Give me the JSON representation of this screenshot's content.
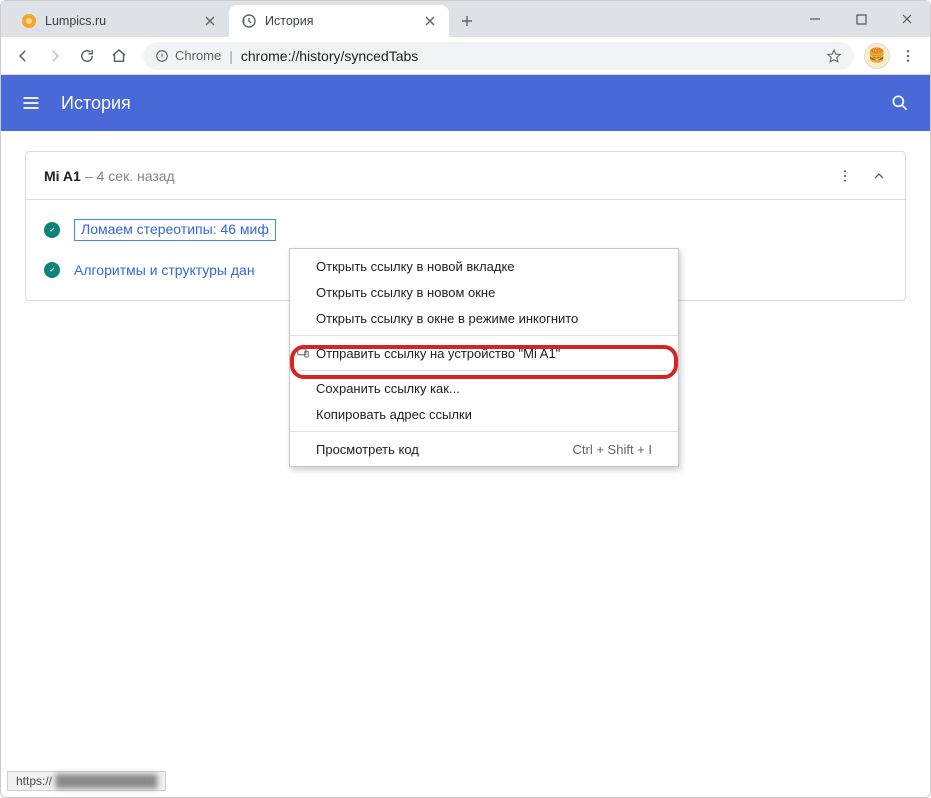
{
  "window": {
    "tabs": [
      {
        "title": "Lumpics.ru",
        "active": false
      },
      {
        "title": "История",
        "active": true
      }
    ]
  },
  "toolbar": {
    "chrome_label": "Chrome",
    "url_path": "chrome://history/syncedTabs"
  },
  "app": {
    "title": "История"
  },
  "device": {
    "name": "Mi A1",
    "time_sep": " – ",
    "time": "4 сек. назад"
  },
  "entries": [
    {
      "title": "Ломаем стереотипы: 46 миф",
      "selected": true
    },
    {
      "title": "Алгоритмы и структуры дан",
      "selected": false
    }
  ],
  "context_menu": {
    "items": [
      {
        "label": "Открыть ссылку в новой вкладке"
      },
      {
        "label": "Открыть ссылку в новом окне"
      },
      {
        "label": "Открыть ссылку в окне в режиме инкогнито"
      }
    ],
    "send_item": {
      "label": "Отправить ссылку на устройство \"Mi A1\""
    },
    "items2": [
      {
        "label": "Сохранить ссылку как..."
      },
      {
        "label": "Копировать адрес ссылки"
      }
    ],
    "inspect": {
      "label": "Просмотреть код",
      "shortcut": "Ctrl + Shift + I"
    }
  },
  "statusbar": {
    "prefix": "https://",
    "blurred": " ████████████ "
  }
}
